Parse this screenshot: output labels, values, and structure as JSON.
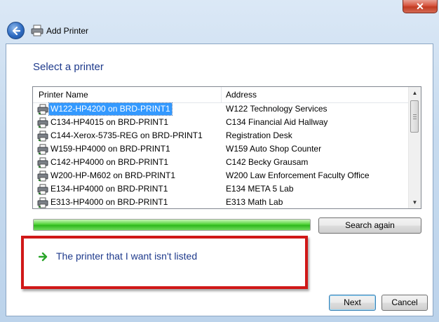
{
  "window": {
    "title": "Add Printer",
    "close_glyph": "✕"
  },
  "page": {
    "heading": "Select a printer"
  },
  "list": {
    "columns": [
      "Printer Name",
      "Address"
    ],
    "rows": [
      {
        "name": "W122-HP4200 on BRD-PRINT1",
        "address": "W122 Technology Services",
        "selected": true
      },
      {
        "name": "C134-HP4015 on BRD-PRINT1",
        "address": "C134 Financial Aid Hallway"
      },
      {
        "name": "C144-Xerox-5735-REG on BRD-PRINT1",
        "address": "Registration Desk"
      },
      {
        "name": "W159-HP4000 on BRD-PRINT1",
        "address": "W159 Auto Shop Counter"
      },
      {
        "name": "C142-HP4000 on BRD-PRINT1",
        "address": "C142 Becky Grausam"
      },
      {
        "name": "W200-HP-M602 on BRD-PRINT1",
        "address": "W200 Law Enforcement Faculty Office"
      },
      {
        "name": "E134-HP4000 on BRD-PRINT1",
        "address": "E134 META 5 Lab"
      },
      {
        "name": "E313-HP4000 on BRD-PRINT1",
        "address": "E313 Math Lab"
      }
    ]
  },
  "progress": {
    "fraction": 1.0
  },
  "buttons": {
    "search_again": "Search again",
    "next": "Next",
    "cancel": "Cancel"
  },
  "not_listed": {
    "label": "The printer that I want isn't listed"
  },
  "colors": {
    "heading": "#1e3a8c",
    "selection": "#3399ff",
    "progress_green": "#2fb81d",
    "annotation_red": "#d01818"
  }
}
